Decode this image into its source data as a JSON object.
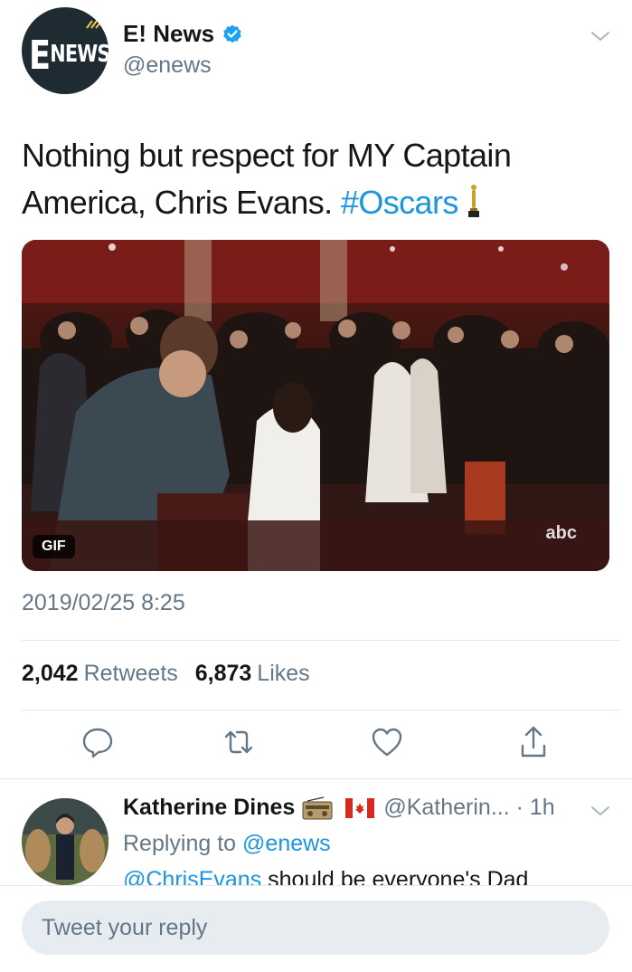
{
  "tweet": {
    "author": {
      "name": "E! News",
      "handle": "@enews",
      "avatar_text": "NEWS",
      "avatar_letter": "E",
      "verified": true
    },
    "text_before": "Nothing but respect for MY Captain America, Chris Evans. ",
    "hashtag": "#Oscars",
    "emoji": "oscar-trophy",
    "media": {
      "type_badge": "GIF",
      "watermark": "abc"
    },
    "timestamp": "2019/02/25 8:25",
    "stats": {
      "retweets_count": "2,042",
      "retweets_label": "Retweets",
      "likes_count": "6,873",
      "likes_label": "Likes"
    },
    "actions": [
      "reply-icon",
      "retweet-icon",
      "like-icon",
      "share-icon"
    ]
  },
  "reply": {
    "name": "Katherine Dines",
    "badges": [
      "radio-emoji",
      "canada-flag-emoji"
    ],
    "handle_time": "@Katherin... · 1h",
    "replying_prefix": "Replying to",
    "replying_to": "@enews",
    "text_mention": "@ChrisEvans",
    "text_rest": " should be everyone's Dad"
  },
  "composer": {
    "placeholder": "Tweet your reply"
  },
  "colors": {
    "link": "#1b95e0",
    "secondary_text": "#657786",
    "divider": "#e1e8ed",
    "compose_bg": "#e6ecf0",
    "verified": "#1da1f2"
  }
}
